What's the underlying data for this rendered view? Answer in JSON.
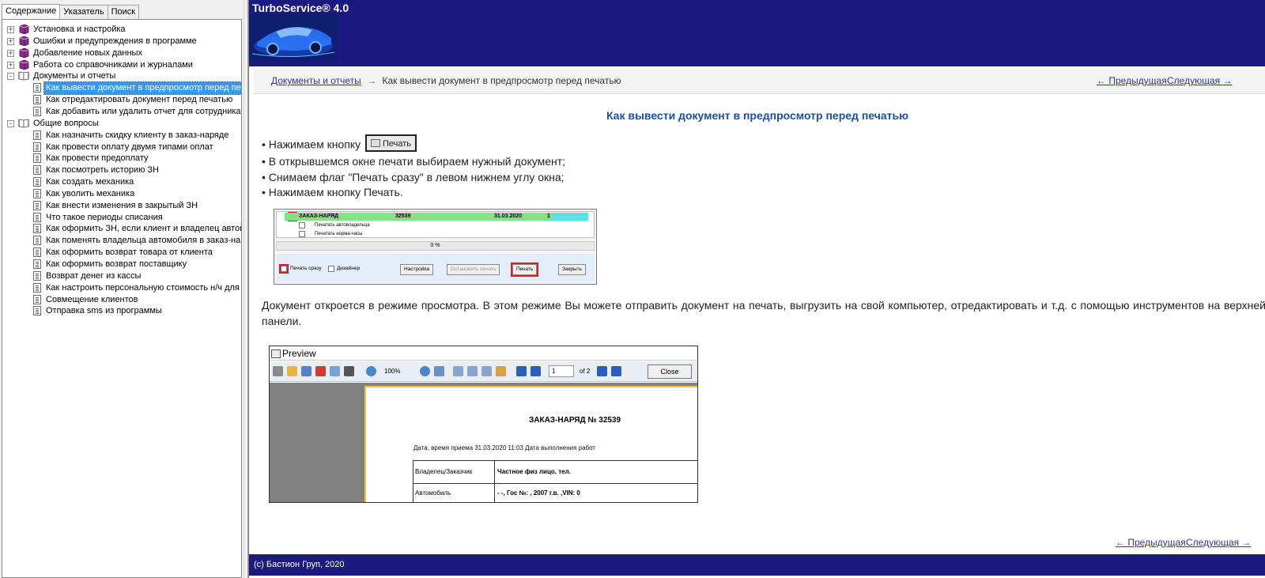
{
  "left_pane": {
    "tabs": [
      {
        "label": "Содержание"
      },
      {
        "label": "Указатель"
      },
      {
        "label": "Поиск"
      }
    ],
    "tree": [
      {
        "label": "Установка и настройка"
      },
      {
        "label": "Ошибки и предупреждения в программе"
      },
      {
        "label": "Добавление новых данных"
      },
      {
        "label": "Работа со справочниками и журналами"
      },
      {
        "label": "Документы и отчеты"
      },
      {
        "label": "Как вывести документ в предпросмотр перед печат"
      },
      {
        "label": "Как отредактировать документ перед печатью"
      },
      {
        "label": "Как добавить или удалить отчет для сотрудника"
      },
      {
        "label": "Общие вопросы"
      },
      {
        "label": "Как назначить скидку клиенту в заказ-наряде"
      },
      {
        "label": "Как провести оплату двумя типами оплат"
      },
      {
        "label": "Как провести предоплату"
      },
      {
        "label": "Как посмотреть историю ЗН"
      },
      {
        "label": "Как создать механика"
      },
      {
        "label": "Как уволить механика"
      },
      {
        "label": "Как внести изменения в закрытый ЗН"
      },
      {
        "label": "Что такое периоды списания"
      },
      {
        "label": "Как оформить ЗН, если клиент и владелец автомоб"
      },
      {
        "label": "Как поменять владельца автомобиля в заказ-наряд"
      },
      {
        "label": "Как оформить возврат товара от клиента"
      },
      {
        "label": "Как оформить возврат поставщику"
      },
      {
        "label": "Возврат денег из кассы"
      },
      {
        "label": "Как настроить персональную стоимость н/ч для кли"
      },
      {
        "label": "Совмещение клиентов"
      },
      {
        "label": "Отправка sms из программы"
      }
    ]
  },
  "header": {
    "app_title": "TurboService® 4.0"
  },
  "nav": {
    "crumb_parent": "Документы и отчеты",
    "crumb_arrow": "→",
    "crumb_current": "Как вывести документ в предпросмотр перед печатью",
    "prev": "← Предыдущая",
    "next": "Следующая →"
  },
  "content": {
    "title": "Как вывести документ в предпросмотр перед печатью",
    "bullet1": "• Нажимаем  кнопку",
    "print_button": "Печать",
    "bullet2": "• В открывшемся окне печати выбираем нужный документ;",
    "bullet3": "• Снимаем флаг \"Печать сразу\" в левом нижнем углу окна;",
    "bullet4": "• Нажимаем кнопку Печать.",
    "paragraph": "Документ откроется в режиме просмотра.  В этом режиме Вы можете отправить документ на печать, выгрузить на свой компьютер, отредактировать и т.д. с помощью инструментов на верхней панели."
  },
  "print_dialog": {
    "row_name": "ЗАКАЗ-НАРЯД",
    "row_number": "32539",
    "row_date": "31.03.2020",
    "row_count": "1",
    "sub1": "Печатать автовладельца",
    "sub2": "Печатать норма-часы",
    "progress": "0 %",
    "print_now": "Печать сразу",
    "designer": "Дизайнер",
    "btn_settings": "Настройка",
    "btn_stop": "Остановить печать",
    "btn_print": "Печать",
    "btn_close": "Закрыть"
  },
  "preview_window": {
    "title": "Preview",
    "zoom": "100%",
    "page": "1",
    "of_pages": "of 2",
    "close": "Close",
    "doc_title": "ЗАКАЗ-НАРЯД № 32539",
    "date_line": "Дата, время приема 31.03.2020 11:03      Дата выполнения работ",
    "row1_label": "Владелец/Заказчик",
    "row1_value": "Частное  физ лицо, тел.",
    "row2_label": "Автомобиль",
    "row2_value": "- -, Гос №: , 2007 г.в. ,VIN: 0"
  },
  "footer": {
    "prev": "← Предыдущая",
    "next": "Следующая →",
    "copyright": "(c) Бастион Груп, 2020"
  },
  "colors": {
    "header_bg": "#1a1a80",
    "link": "#33339a",
    "title": "#1f4e9a",
    "selection": "#3399ff"
  }
}
